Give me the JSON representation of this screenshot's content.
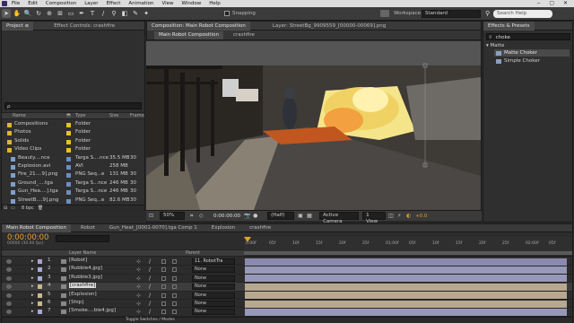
{
  "menubar": {
    "items": [
      "File",
      "Edit",
      "Composition",
      "Layer",
      "Effect",
      "Animation",
      "View",
      "Window",
      "Help"
    ],
    "controls": "‒ ▢ ✕"
  },
  "toolbar": {
    "snapping": "Snapping",
    "workspace_label": "Workspace:",
    "workspace_value": "Standard",
    "search_placeholder": "Search Help"
  },
  "project_panel": {
    "tabs": [
      "Project ≡",
      "Effect Controls: crashfire"
    ],
    "search_value": "ρ",
    "columns": {
      "name": "Name",
      "type": "Type",
      "size": "Size",
      "frame": "Frame"
    },
    "items": [
      {
        "name": "Compositions",
        "type": "Folder",
        "size": "",
        "frame": "",
        "label_color": "#e8c220",
        "icon": "folder-icon"
      },
      {
        "name": "Photos",
        "type": "Folder",
        "size": "",
        "frame": "",
        "label_color": "#e8c220",
        "icon": "folder-icon"
      },
      {
        "name": "Solids",
        "type": "Folder",
        "size": "",
        "frame": "",
        "label_color": "#e8c220",
        "icon": "folder-icon"
      },
      {
        "name": "Video Clips",
        "type": "Folder",
        "size": "",
        "frame": "",
        "label_color": "#e8c220",
        "icon": "folder-icon"
      },
      {
        "name": "Beauty....nce",
        "type": "Targa S....nce",
        "size": "35.5 MB",
        "frame": "30",
        "label_color": "#6a8fbf",
        "icon": "footage-icon"
      },
      {
        "name": "Explosion.avi",
        "type": "AVI",
        "size": "258 MB",
        "frame": "",
        "label_color": "#6a8fbf",
        "icon": "footage-icon"
      },
      {
        "name": "Fire_21....9].png",
        "type": "PNG Seq...e",
        "size": "131 MB",
        "frame": "30",
        "label_color": "#6a8fbf",
        "icon": "footage-icon"
      },
      {
        "name": "Ground_....tga",
        "type": "Targa S...nce",
        "size": "246 MB",
        "frame": "30",
        "label_color": "#6a8fbf",
        "icon": "footage-icon"
      },
      {
        "name": "Gun_Hea....].tga",
        "type": "Targa S...nce",
        "size": "246 MB",
        "frame": "30",
        "label_color": "#6a8fbf",
        "icon": "footage-icon"
      },
      {
        "name": "StreetB....9].png",
        "type": "PNG Seq...e",
        "size": "82.6 MB",
        "frame": "30",
        "label_color": "#6a8fbf",
        "icon": "footage-icon"
      }
    ],
    "bpc": "8 bpc"
  },
  "composition_panel": {
    "tab": "Composition: Main Robot Composition",
    "layer_tab": "Layer: StreetBg_9909559_[00000-00069].png",
    "breadcrumbs": [
      "Main Robot Composition",
      "crashfire"
    ],
    "footer": {
      "zoom": "50%",
      "timecode": "0:00:00:00",
      "resolution": "(Half)",
      "camera": "Active Camera",
      "view": "1 View",
      "exposure": "+0.0"
    }
  },
  "effects_panel": {
    "tab": "Effects & Presets",
    "search_value": "choke",
    "category": "▾ Matte",
    "items": [
      "Matte Choker",
      "Simple Choker"
    ],
    "selected_index": 0
  },
  "timeline": {
    "tabs": [
      "Main Robot Composition",
      "Robot",
      "Gun_Heat_[0001-0070].tga Comp 1",
      "Explosion",
      "crashfire"
    ],
    "timecode": "0:00:00:00",
    "fps": "00000 (30.00 fps)",
    "ruler": [
      "0:00f",
      "05f",
      "10f",
      "15f",
      "20f",
      "25f",
      "01:00f",
      "05f",
      "10f",
      "15f",
      "20f",
      "25f",
      "02:00f",
      "05f"
    ],
    "col_layer_name": "Layer Name",
    "col_parent": "Parent",
    "layers": [
      {
        "num": "1",
        "name": "[Robot]",
        "parent": "11. RobotTra",
        "color": "#8a8ab0",
        "label": "#b0a0d0"
      },
      {
        "num": "2",
        "name": "[Rubble4.jpg]",
        "parent": "None",
        "color": "#9898b8",
        "label": "#a7a7d6"
      },
      {
        "num": "3",
        "name": "[Rubble3.jpg]",
        "parent": "None",
        "color": "#9898b8",
        "label": "#a7a7d6"
      },
      {
        "num": "4",
        "name": "[crashfire]",
        "parent": "None",
        "color": "#b8a890",
        "label": "#c9b890",
        "selected": true
      },
      {
        "num": "5",
        "name": "[Explosion]",
        "parent": "None",
        "color": "#b8a890",
        "label": "#c9b890"
      },
      {
        "num": "6",
        "name": "[Ship]",
        "parent": "None",
        "color": "#b8a890",
        "label": "#c9b890"
      },
      {
        "num": "7",
        "name": "[Smoke....ble4.jpg]",
        "parent": "None",
        "color": "#9898b8",
        "label": "#a7a7d6"
      },
      {
        "num": "8",
        "name": "[Rubble2.jpg]",
        "parent": "None",
        "color": "#9898b8",
        "label": "#a7a7d6"
      }
    ],
    "footer": "Toggle Switches / Modes"
  }
}
